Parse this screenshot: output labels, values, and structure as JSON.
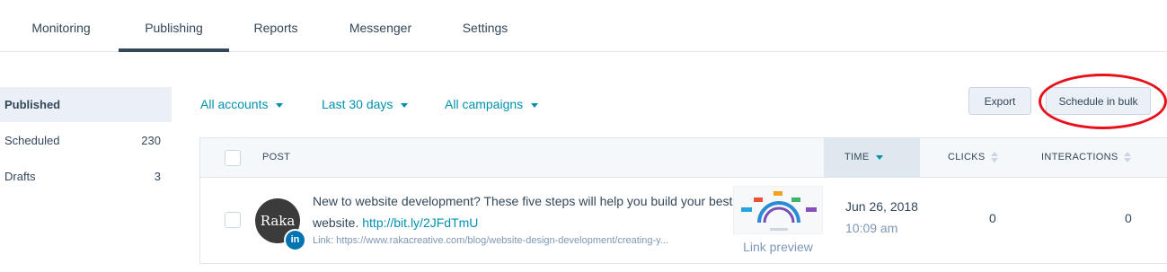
{
  "nav": {
    "tabs": [
      {
        "label": "Monitoring"
      },
      {
        "label": "Publishing"
      },
      {
        "label": "Reports"
      },
      {
        "label": "Messenger"
      },
      {
        "label": "Settings"
      }
    ],
    "active_tab": "Publishing"
  },
  "sidebar": {
    "items": [
      {
        "label": "Published",
        "count": ""
      },
      {
        "label": "Scheduled",
        "count": "230"
      },
      {
        "label": "Drafts",
        "count": "3"
      }
    ]
  },
  "filters": {
    "accounts": "All accounts",
    "range": "Last 30 days",
    "campaigns": "All campaigns"
  },
  "actions": {
    "export": "Export",
    "schedule_bulk": "Schedule in bulk"
  },
  "table": {
    "columns": {
      "post": "POST",
      "time": "TIME",
      "clicks": "CLICKS",
      "interactions": "INTERACTIONS"
    },
    "rows": [
      {
        "avatar_text": "Raka",
        "network_badge": "in",
        "network_icon": "linkedin-icon",
        "text": "New to website development? These five steps will help you build your best website.",
        "short_link": "http://bit.ly/2JFdTmU",
        "link_line": "Link: https://www.rakacreative.com/blog/website-design-development/creating-y...",
        "preview_label": "Link preview",
        "date": "Jun 26, 2018",
        "time": "10:09 am",
        "clicks": "0",
        "interactions": "0"
      }
    ]
  },
  "colors": {
    "accent": "#0091ae",
    "text": "#33475b",
    "highlight_ring": "#e8101a",
    "linkedin": "#0073b1"
  }
}
